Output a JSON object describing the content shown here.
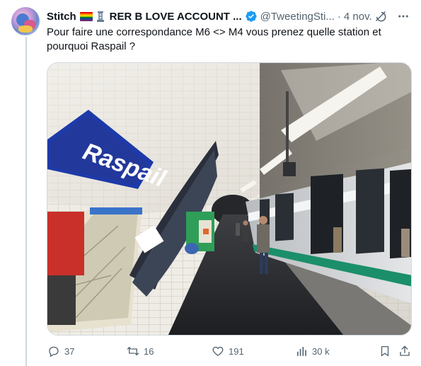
{
  "tweet": {
    "display_name": "Stitch",
    "account_title": "RER B LOVE ACCOUNT ...",
    "handle": "@TweetingSti...",
    "separator": "·",
    "date": "4 nov.",
    "text": "Pour faire une correspondance M6 <> M4 vous prenez quelle station et pourquoi Raspail ?",
    "media": {
      "station_sign": "Raspail"
    },
    "stats": {
      "replies": "37",
      "retweets": "16",
      "likes": "191",
      "views": "30 k"
    }
  },
  "colors": {
    "text_primary": "#0f1419",
    "text_secondary": "#536471",
    "verified_blue": "#1d9bf0",
    "divider": "#cfd9de"
  },
  "icons": {
    "reply": "reply-icon",
    "retweet": "retweet-icon",
    "like": "heart-icon",
    "views": "analytics-icon",
    "bookmark": "bookmark-icon",
    "share": "share-icon",
    "grok": "grok-icon",
    "more": "more-icon"
  }
}
